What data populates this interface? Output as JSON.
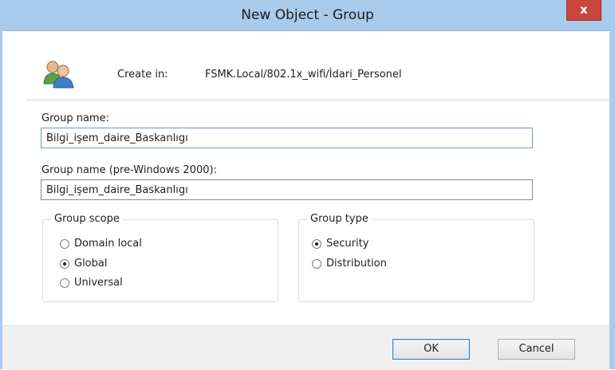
{
  "window": {
    "title": "New Object - Group",
    "close_glyph": "x"
  },
  "create_in": {
    "label": "Create in:",
    "path": "FSMK.Local/802.1x_wifi/İdari_Personel",
    "icon": "group-users-icon"
  },
  "group_name": {
    "label": "Group name:",
    "value": "Bilgi_işem_daire_Baskanlıgı"
  },
  "group_name_pre2000": {
    "label": "Group name (pre-Windows 2000):",
    "value": "Bilgi_işem_daire_Baskanlıgı"
  },
  "group_scope": {
    "legend": "Group scope",
    "options": [
      {
        "label": "Domain local",
        "checked": false
      },
      {
        "label": "Global",
        "checked": true
      },
      {
        "label": "Universal",
        "checked": false
      }
    ]
  },
  "group_type": {
    "legend": "Group type",
    "options": [
      {
        "label": "Security",
        "checked": true
      },
      {
        "label": "Distribution",
        "checked": false
      }
    ]
  },
  "buttons": {
    "ok": "OK",
    "cancel": "Cancel"
  },
  "colors": {
    "titlebar": "#a8cbec",
    "close": "#c9463d",
    "footer": "#f0f0f0"
  }
}
